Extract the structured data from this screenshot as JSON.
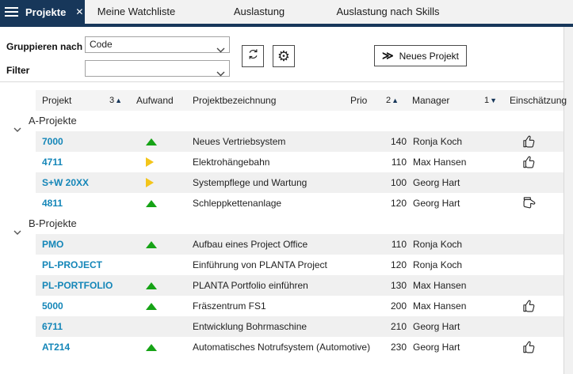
{
  "tab_bar": {
    "active_tab": "Projekte",
    "close_glyph": "✕",
    "tabs": [
      "Meine Watchliste",
      "Auslastung",
      "Auslastung nach Skills"
    ]
  },
  "toolbar": {
    "group_by_label": "Gruppieren nach",
    "group_by_value": "Code",
    "filter_label": "Filter",
    "filter_value": "",
    "new_project_glyph": "≫",
    "new_project_label": "Neues Projekt",
    "settings_glyph": "⚙"
  },
  "table": {
    "columns": {
      "projekt": {
        "label": "Projekt",
        "sort_order": "3",
        "sort_glyph": "▲"
      },
      "aufwand": {
        "label": "Aufwand"
      },
      "bezeichnung": {
        "label": "Projektbezeichnung"
      },
      "prio": {
        "label": "Prio",
        "sort_order": "2",
        "sort_glyph": "▲"
      },
      "manager": {
        "label": "Manager",
        "sort_order": "1",
        "sort_glyph": "▼"
      },
      "einschaetzung": {
        "label": "Einschätzung"
      }
    },
    "groups": [
      {
        "label": "A-Projekte",
        "rows": [
          {
            "code": "7000",
            "trend": "up",
            "desc": "Neues Vertriebsystem",
            "prio": "140",
            "manager": "Ronja Koch",
            "rating": "up"
          },
          {
            "code": "4711",
            "trend": "right",
            "desc": "Elektrohängebahn",
            "prio": "110",
            "manager": "Max Hansen",
            "rating": "up"
          },
          {
            "code": "S+W 20XX",
            "trend": "right",
            "desc": "Systempflege und Wartung",
            "prio": "100",
            "manager": "Georg Hart",
            "rating": "none"
          },
          {
            "code": "4811",
            "trend": "up",
            "desc": "Schleppkettenanlage",
            "prio": "120",
            "manager": "Georg Hart",
            "rating": "neutral"
          }
        ]
      },
      {
        "label": "B-Projekte",
        "rows": [
          {
            "code": "PMO",
            "trend": "up",
            "desc": "Aufbau eines Project Office",
            "prio": "110",
            "manager": "Ronja Koch",
            "rating": "none"
          },
          {
            "code": "PL-PROJECT",
            "trend": "none",
            "desc": "Einführung von PLANTA Project",
            "prio": "120",
            "manager": "Ronja Koch",
            "rating": "none"
          },
          {
            "code": "PL-PORTFOLIO",
            "trend": "up",
            "desc": "PLANTA Portfolio einführen",
            "prio": "130",
            "manager": "Max Hansen",
            "rating": "none"
          },
          {
            "code": "5000",
            "trend": "up",
            "desc": "Fräszentrum FS1",
            "prio": "200",
            "manager": "Max Hansen",
            "rating": "up"
          },
          {
            "code": "6711",
            "trend": "none",
            "desc": "Entwicklung Bohrmaschine",
            "prio": "210",
            "manager": "Georg Hart",
            "rating": "none"
          },
          {
            "code": "AT214",
            "trend": "up",
            "desc": "Automatisches Notrufsystem (Automotive)",
            "prio": "230",
            "manager": "Georg Hart",
            "rating": "up"
          }
        ]
      }
    ]
  },
  "colors": {
    "navy": "#17375a",
    "link_blue": "#1486b8",
    "trend_up_green": "#16a316",
    "trend_warn_yellow": "#f3c51a",
    "row_shade": "#f0f0f0"
  }
}
